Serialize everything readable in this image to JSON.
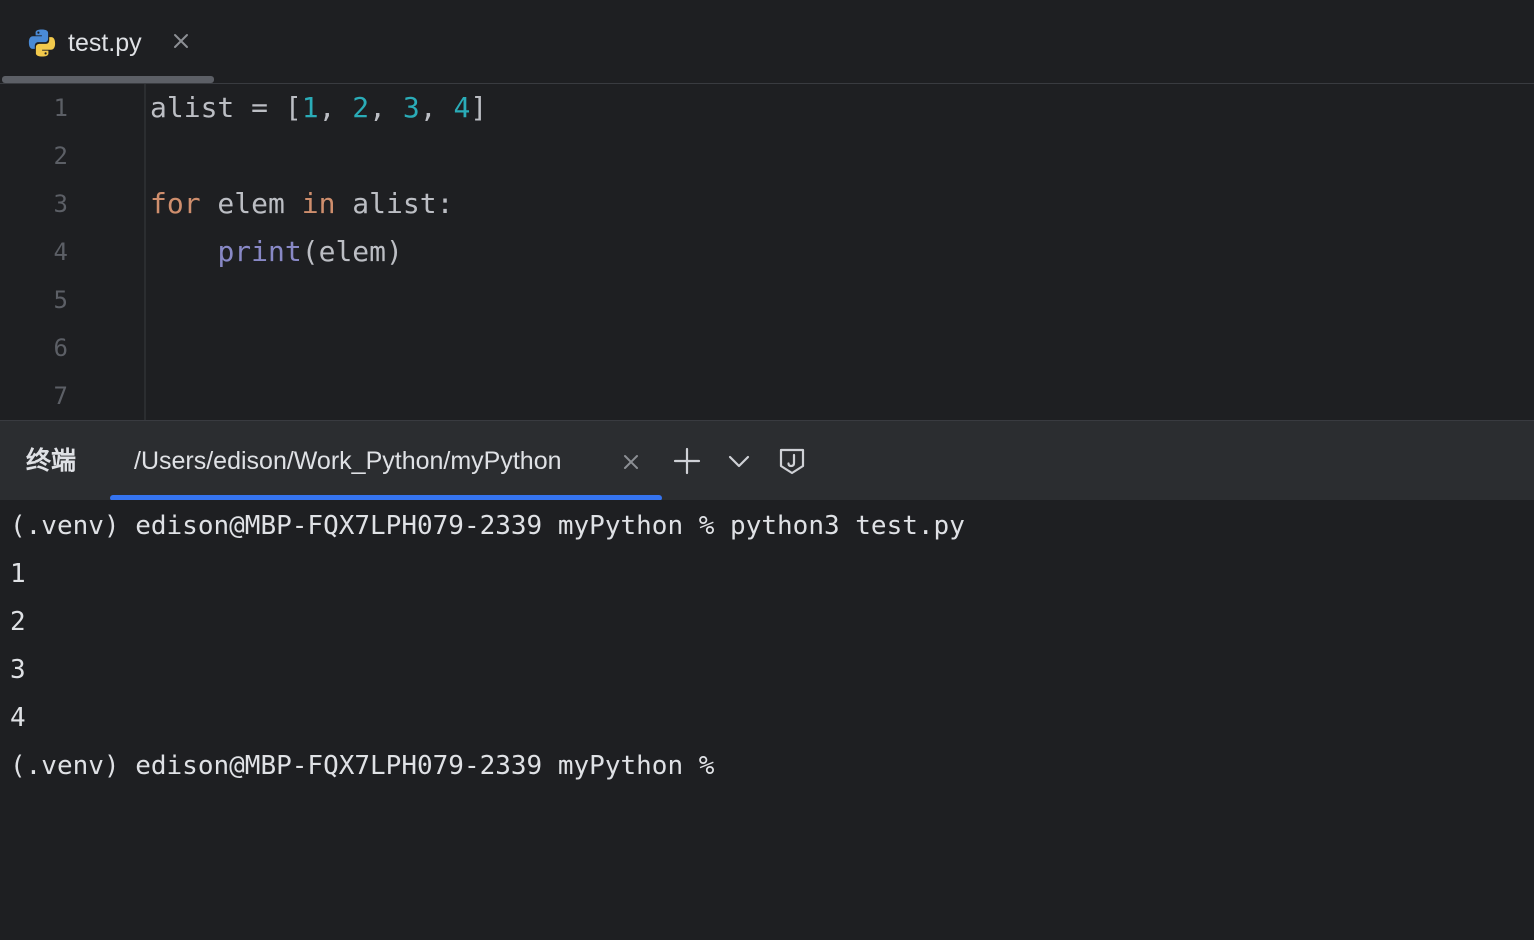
{
  "editor": {
    "tab": {
      "label": "test.py",
      "icon": "python-icon"
    },
    "line_numbers": [
      "1",
      "2",
      "3",
      "4",
      "5",
      "6",
      "7"
    ],
    "code": {
      "line1": {
        "a": "alist = [",
        "n1": "1",
        "s1": ", ",
        "n2": "2",
        "s2": ", ",
        "n3": "3",
        "s3": ", ",
        "n4": "4",
        "close": "]"
      },
      "line3": {
        "kw_for": "for",
        "mid": " elem ",
        "kw_in": "in",
        "end": " alist:"
      },
      "line4": {
        "indent": "    ",
        "builtin": "print",
        "args": "(elem)"
      }
    },
    "colors": {
      "number": "#2aacb8",
      "keyword": "#cf8e6d",
      "builtin": "#8888c6",
      "text": "#bcbec4"
    }
  },
  "terminal": {
    "title": "终端",
    "tab_label": "/Users/edison/Work_Python/myPython",
    "icons": {
      "add": "plus-icon",
      "dropdown": "chevron-down-icon",
      "shield": "shield-icon"
    },
    "accent_color": "#3574f0",
    "lines": [
      "(.venv) edison@MBP-FQX7LPH079-2339 myPython % python3 test.py",
      "1",
      "2",
      "3",
      "4",
      "(.venv) edison@MBP-FQX7LPH079-2339 myPython %"
    ]
  }
}
